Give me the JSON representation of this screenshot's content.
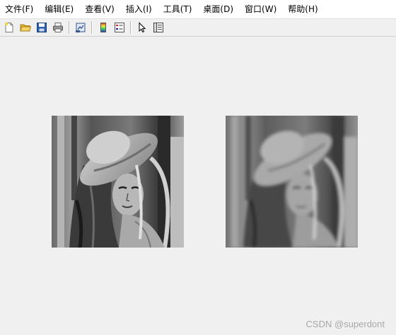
{
  "menu": {
    "items": [
      {
        "id": "file",
        "label": "文件(F)"
      },
      {
        "id": "edit",
        "label": "编辑(E)"
      },
      {
        "id": "view",
        "label": "查看(V)"
      },
      {
        "id": "insert",
        "label": "插入(I)"
      },
      {
        "id": "tools",
        "label": "工具(T)"
      },
      {
        "id": "desktop",
        "label": "桌面(D)"
      },
      {
        "id": "window",
        "label": "窗口(W)"
      },
      {
        "id": "help",
        "label": "帮助(H)"
      }
    ]
  },
  "toolbar": {
    "buttons": [
      {
        "name": "new-figure-icon"
      },
      {
        "name": "open-folder-icon"
      },
      {
        "name": "save-icon"
      },
      {
        "name": "print-icon"
      },
      {
        "name": "link-plot-icon"
      },
      {
        "name": "colorbar-icon"
      },
      {
        "name": "legend-icon"
      },
      {
        "name": "pointer-icon"
      },
      {
        "name": "property-editor-icon"
      }
    ]
  },
  "figure": {
    "images": [
      {
        "name": "original-image",
        "style": "grayscale-sharp"
      },
      {
        "name": "processed-image",
        "style": "grayscale-blurred"
      }
    ]
  },
  "watermark": {
    "text": "CSDN @superdont"
  }
}
